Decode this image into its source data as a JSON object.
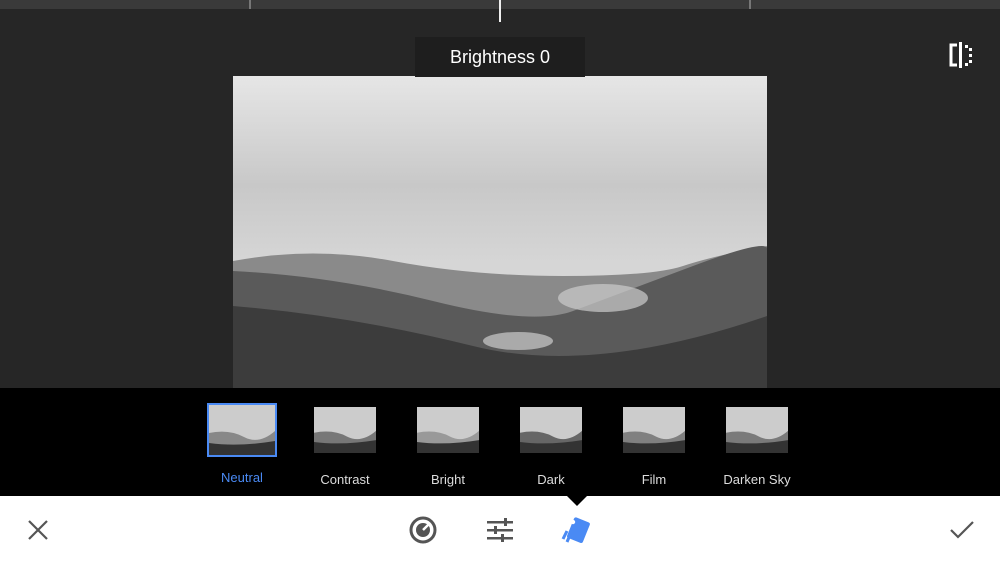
{
  "slider": {
    "label": "Brightness 0",
    "value": 0
  },
  "presets": [
    {
      "label": "Neutral",
      "selected": true
    },
    {
      "label": "Contrast",
      "selected": false
    },
    {
      "label": "Bright",
      "selected": false
    },
    {
      "label": "Dark",
      "selected": false
    },
    {
      "label": "Film",
      "selected": false
    },
    {
      "label": "Darken Sky",
      "selected": false
    }
  ],
  "colors": {
    "accent": "#4a8af4",
    "background": "#262626"
  },
  "toolbar": {
    "icons": [
      "close-icon",
      "tonal-contrast-icon",
      "adjust-sliders-icon",
      "styles-icon",
      "check-icon"
    ]
  }
}
